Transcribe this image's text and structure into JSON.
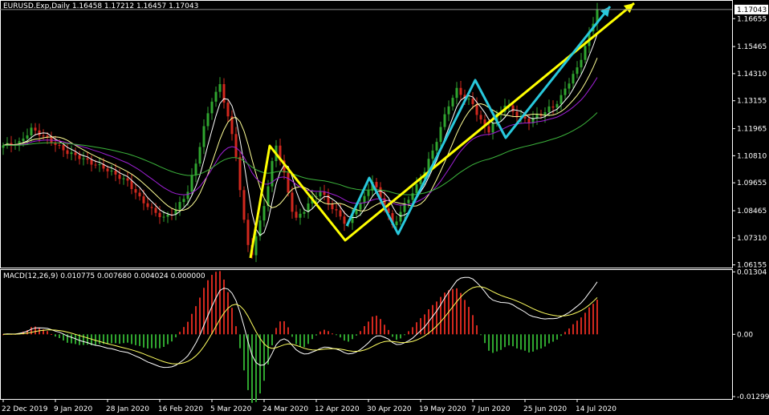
{
  "main_chart": {
    "header": "EURUSD.Exp,Daily  1.16458 1.17212 1.16457 1.17043",
    "current_price": "1.17043",
    "price_ticks": [
      "1.16655",
      "1.15465",
      "1.14310",
      "1.13155",
      "1.11965",
      "1.10810",
      "1.09655",
      "1.08465",
      "1.07310",
      "1.06155"
    ],
    "price_values": [
      1.16655,
      1.15465,
      1.1431,
      1.13155,
      1.11965,
      1.1081,
      1.09655,
      1.08465,
      1.0731,
      1.06155
    ],
    "current_value": 1.17043,
    "ylim": [
      1.0604,
      1.1745
    ]
  },
  "macd_panel": {
    "header": "MACD(12,26,9) 0.010775 0.007680 0.004024 0.000000",
    "ticks": [
      "0.01304",
      "0.00",
      "-0.012998"
    ],
    "tick_values": [
      0.01304,
      0.0,
      -0.012998
    ],
    "ylim": [
      -0.0135,
      0.0136
    ]
  },
  "x_axis": {
    "labels": [
      "22 Dec 2019",
      "9 Jan 2020",
      "28 Jan 2020",
      "16 Feb 2020",
      "5 Mar 2020",
      "24 Mar 2020",
      "12 Apr 2020",
      "30 Apr 2020",
      "19 May 2020",
      "7 Jun 2020",
      "25 Jun 2020",
      "14 Jul 2020"
    ],
    "label_bars": [
      0,
      13,
      26,
      39,
      52,
      65,
      78,
      91,
      104,
      117,
      130,
      143
    ]
  },
  "colors": {
    "background": "#000000",
    "grid": "#ffffff",
    "bull": "#2fa52f",
    "bear": "#d2281e",
    "ma_fast": "#ffff96",
    "ma_mid": "#ffffff",
    "ma_slow": "#a020d8",
    "ma_long": "#3cb43c",
    "annot_yellow": "#ffff00",
    "annot_cyan": "#28c8dc",
    "macd_pos": "#d2281e",
    "macd_neg": "#2fa52f",
    "macd_line": "#ffffff",
    "signal_line": "#ffff60"
  },
  "chart_data": [
    {
      "type": "candlestick",
      "symbol": "EURUSD.Exp",
      "timeframe": "Daily",
      "close_path": [
        [
          0,
          1.1125
        ],
        [
          4,
          1.1135
        ],
        [
          7,
          1.1195
        ],
        [
          10,
          1.1165
        ],
        [
          13,
          1.113
        ],
        [
          16,
          1.1095
        ],
        [
          19,
          1.1075
        ],
        [
          22,
          1.105
        ],
        [
          25,
          1.103
        ],
        [
          28,
          1.1
        ],
        [
          31,
          1.097
        ],
        [
          34,
          1.09
        ],
        [
          37,
          1.085
        ],
        [
          40,
          1.0815
        ],
        [
          43,
          1.085
        ],
        [
          46,
          1.093
        ],
        [
          48,
          1.105
        ],
        [
          50,
          1.12
        ],
        [
          52,
          1.132
        ],
        [
          54,
          1.138
        ],
        [
          56,
          1.125
        ],
        [
          58,
          1.108
        ],
        [
          60,
          1.08
        ],
        [
          61,
          1.07
        ],
        [
          62,
          1.0665
        ],
        [
          64,
          1.08
        ],
        [
          66,
          1.095
        ],
        [
          67,
          1.105
        ],
        [
          68,
          1.113
        ],
        [
          70,
          1.1
        ],
        [
          72,
          1.085
        ],
        [
          73,
          1.081
        ],
        [
          75,
          1.085
        ],
        [
          77,
          1.09
        ],
        [
          79,
          1.093
        ],
        [
          81,
          1.088
        ],
        [
          83,
          1.084
        ],
        [
          85,
          1.08
        ],
        [
          86,
          1.079
        ],
        [
          88,
          1.086
        ],
        [
          90,
          1.09
        ],
        [
          92,
          1.0975
        ],
        [
          94,
          1.09
        ],
        [
          96,
          1.083
        ],
        [
          97,
          1.078
        ],
        [
          99,
          1.084
        ],
        [
          101,
          1.09
        ],
        [
          103,
          1.095
        ],
        [
          105,
          1.102
        ],
        [
          107,
          1.11
        ],
        [
          109,
          1.12
        ],
        [
          111,
          1.13
        ],
        [
          113,
          1.136
        ],
        [
          115,
          1.133
        ],
        [
          117,
          1.13
        ],
        [
          119,
          1.123
        ],
        [
          120,
          1.12
        ],
        [
          121,
          1.119
        ],
        [
          123,
          1.125
        ],
        [
          125,
          1.13
        ],
        [
          127,
          1.127
        ],
        [
          129,
          1.124
        ],
        [
          131,
          1.123
        ],
        [
          133,
          1.125
        ],
        [
          135,
          1.127
        ],
        [
          137,
          1.129
        ],
        [
          139,
          1.133
        ],
        [
          141,
          1.14
        ],
        [
          143,
          1.145
        ],
        [
          145,
          1.155
        ],
        [
          147,
          1.165
        ],
        [
          148,
          1.1704
        ]
      ]
    },
    {
      "type": "bar",
      "name": "MACD(12,26,9)",
      "values": [
        0.010775,
        0.00768,
        0.004024,
        0.0
      ]
    }
  ]
}
